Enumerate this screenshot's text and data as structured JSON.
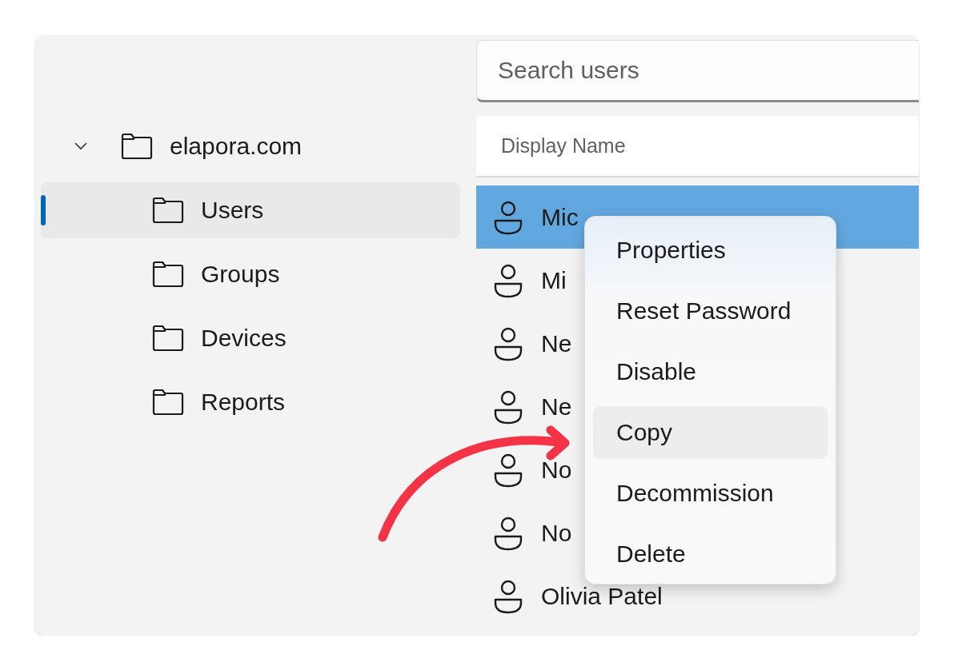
{
  "search": {
    "placeholder": "Search users"
  },
  "tree": [
    {
      "label": "elapora.com",
      "expanded": true,
      "selected": false,
      "children": [
        {
          "label": "Users",
          "selected": true
        },
        {
          "label": "Groups",
          "selected": false
        },
        {
          "label": "Devices",
          "selected": false
        },
        {
          "label": "Reports",
          "selected": false
        }
      ]
    }
  ],
  "table": {
    "columns": [
      "Display Name"
    ],
    "rows": [
      {
        "name": "Mic",
        "selected": true
      },
      {
        "name": "Mi",
        "selected": false
      },
      {
        "name": "Ne",
        "selected": false
      },
      {
        "name": "Ne",
        "selected": false
      },
      {
        "name": "No",
        "selected": false
      },
      {
        "name": "No",
        "selected": false
      },
      {
        "name": "Olivia Patel",
        "selected": false
      }
    ]
  },
  "context_menu": {
    "items": [
      {
        "label": "Properties",
        "selected": false
      },
      {
        "label": "Reset Password",
        "selected": false
      },
      {
        "label": "Disable",
        "selected": false
      },
      {
        "label": "Copy",
        "selected": true
      },
      {
        "label": "Decommission",
        "selected": false
      },
      {
        "label": "Delete",
        "selected": false
      }
    ]
  }
}
